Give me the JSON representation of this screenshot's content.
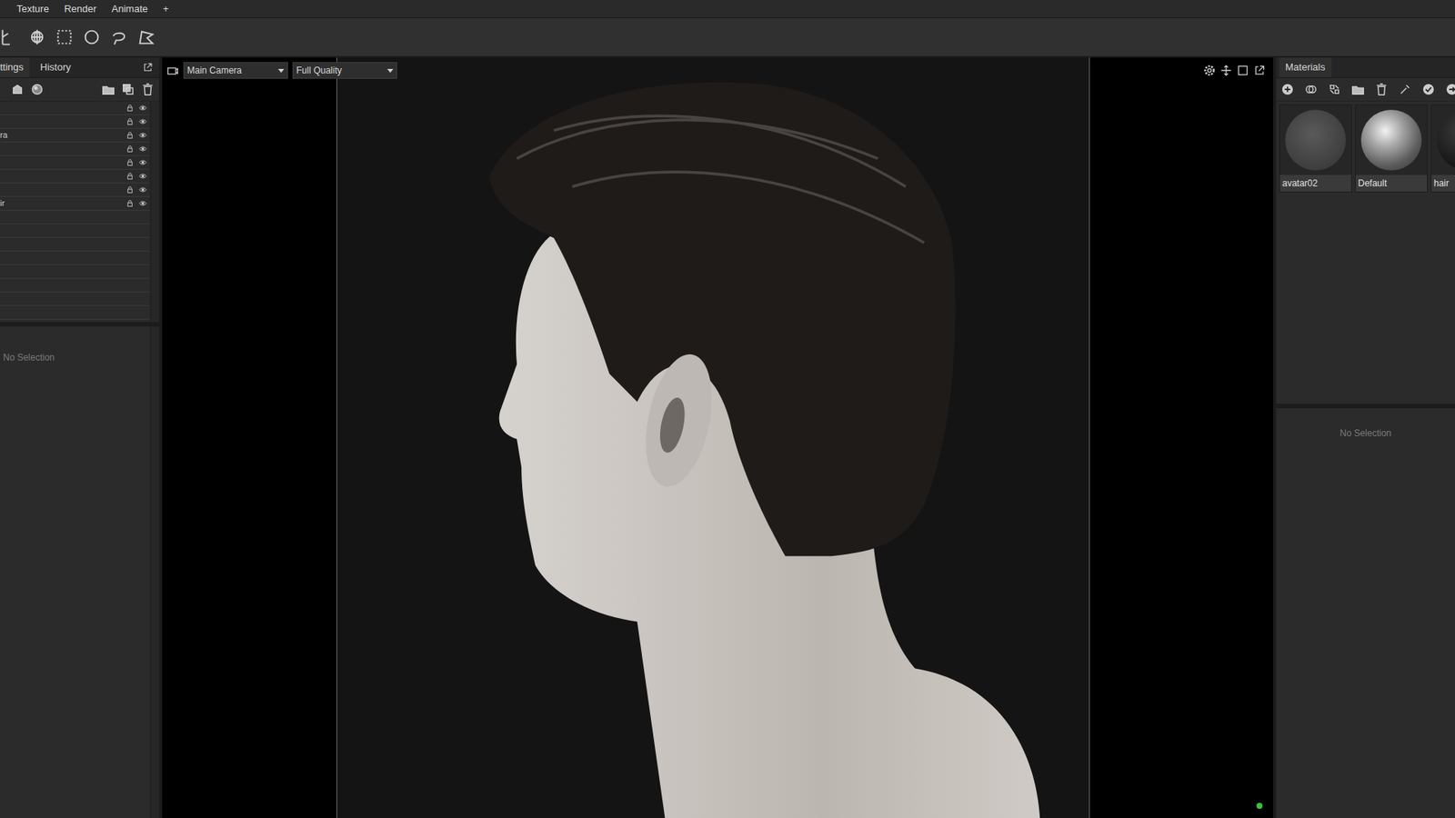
{
  "menu": [
    {
      "label": "Texture"
    },
    {
      "label": "Render"
    },
    {
      "label": "Animate"
    },
    {
      "label": "+"
    }
  ],
  "left_panel": {
    "tabs": [
      {
        "label": "ttings",
        "selected": true
      },
      {
        "label": "History",
        "selected": false
      }
    ],
    "scene_rows": [
      {
        "label": ""
      },
      {
        "label": ""
      },
      {
        "label": "ra"
      },
      {
        "label": ""
      },
      {
        "label": ""
      },
      {
        "label": ""
      },
      {
        "label": ""
      },
      {
        "label": "ir"
      }
    ],
    "properties": "No Selection"
  },
  "viewport": {
    "camera": "Main Camera",
    "quality": "Full Quality",
    "status_dot": {
      "color": "#3fbf3f"
    }
  },
  "right_panel": {
    "tab": "Materials",
    "materials": [
      {
        "name": "avatar02",
        "kind": "matte"
      },
      {
        "name": "Default",
        "kind": "glossy"
      },
      {
        "name": "hair",
        "kind": "dark"
      }
    ],
    "properties": "No Selection"
  }
}
